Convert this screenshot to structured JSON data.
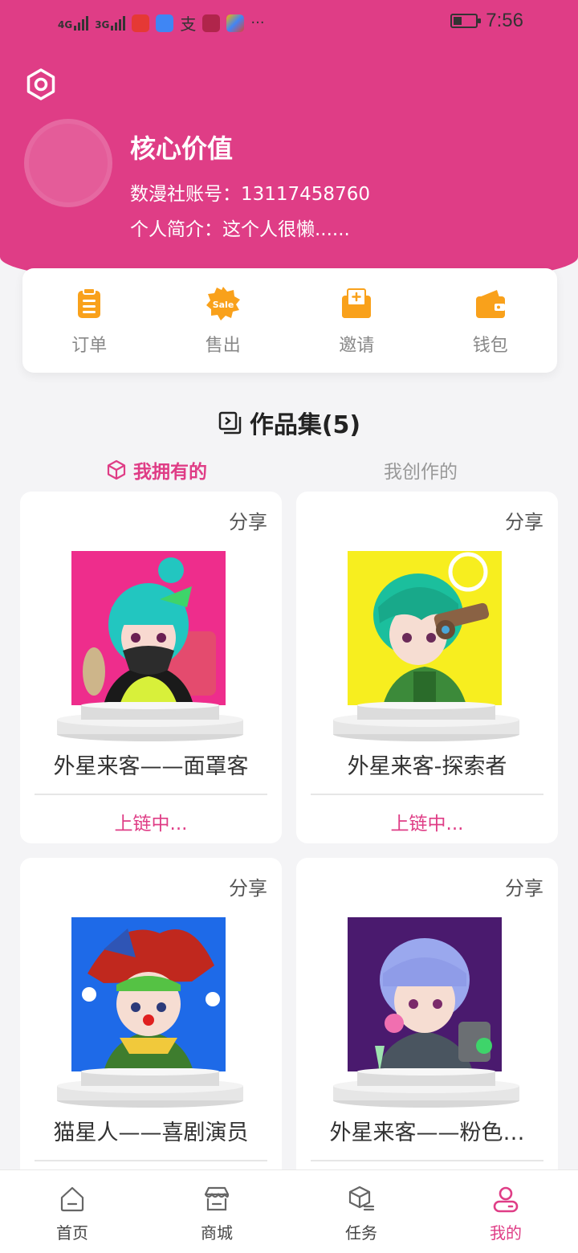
{
  "status_bar": {
    "time": "7:56",
    "network_1": "4G",
    "network_2": "3G"
  },
  "profile": {
    "name": "核心价值",
    "account": "数漫社账号：13117458760",
    "bio": "个人简介：这个人很懒......"
  },
  "quick_actions": [
    {
      "label": "订单",
      "icon": "clipboard-icon"
    },
    {
      "label": "售出",
      "icon": "sale-badge-icon",
      "badge_text": "Sale"
    },
    {
      "label": "邀请",
      "icon": "invite-envelope-icon"
    },
    {
      "label": "钱包",
      "icon": "wallet-icon"
    }
  ],
  "collection": {
    "title": "作品集(5)",
    "tabs": [
      {
        "label": "我拥有的",
        "active": true
      },
      {
        "label": "我创作的",
        "active": false
      }
    ]
  },
  "cards": [
    {
      "share": "分享",
      "title": "外星来客——面罩客",
      "status": "上链中..."
    },
    {
      "share": "分享",
      "title": "外星来客-探索者",
      "status": "上链中..."
    },
    {
      "share": "分享",
      "title": "猫星人——喜剧演员",
      "status": ""
    },
    {
      "share": "分享",
      "title": "外星来客——粉色…",
      "status": ""
    }
  ],
  "tabbar": [
    {
      "label": "首页",
      "icon": "home-icon",
      "active": false
    },
    {
      "label": "商城",
      "icon": "store-icon",
      "active": false
    },
    {
      "label": "任务",
      "icon": "task-box-icon",
      "active": false
    },
    {
      "label": "我的",
      "icon": "profile-icon",
      "active": true
    }
  ],
  "colors": {
    "accent": "#df3d86",
    "icon_orange": "#f9a11b"
  }
}
